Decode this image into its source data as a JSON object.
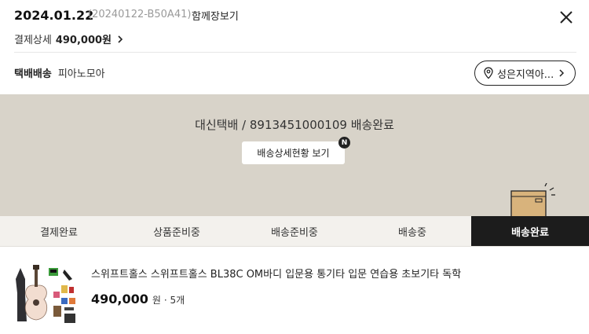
{
  "header": {
    "order_date": "2024.01.22",
    "order_number": "(20240122-B50A41)",
    "together_link": "함께장보기",
    "payment_label": "결제상세",
    "payment_amount": "490,000원"
  },
  "shipping": {
    "method": "택배배송",
    "seller": "피아노모아",
    "location_button": "성은지역아..."
  },
  "delivery_status": {
    "courier_text": "대신택배 / 8913451000109 배송완료",
    "detail_button": "배송상세현황 보기",
    "new_badge": "N"
  },
  "steps": [
    {
      "label": "결제완료",
      "active": false
    },
    {
      "label": "상품준비중",
      "active": false
    },
    {
      "label": "배송준비중",
      "active": false
    },
    {
      "label": "배송중",
      "active": false
    },
    {
      "label": "배송완료",
      "active": true
    }
  ],
  "product": {
    "name": "스위프트홀스 스위프트홀스 BL38C OM바디 입문용 통기타 입문 연습용 초보기타 독학",
    "price": "490,000",
    "price_unit": "원",
    "quantity": "· 5개"
  },
  "icons": [
    "close-icon",
    "chevron-right-icon",
    "location-pin-icon",
    "box-icon"
  ],
  "colors": {
    "panel_bg": "#d8d3c9",
    "active_step_bg": "#1c1c1c"
  }
}
